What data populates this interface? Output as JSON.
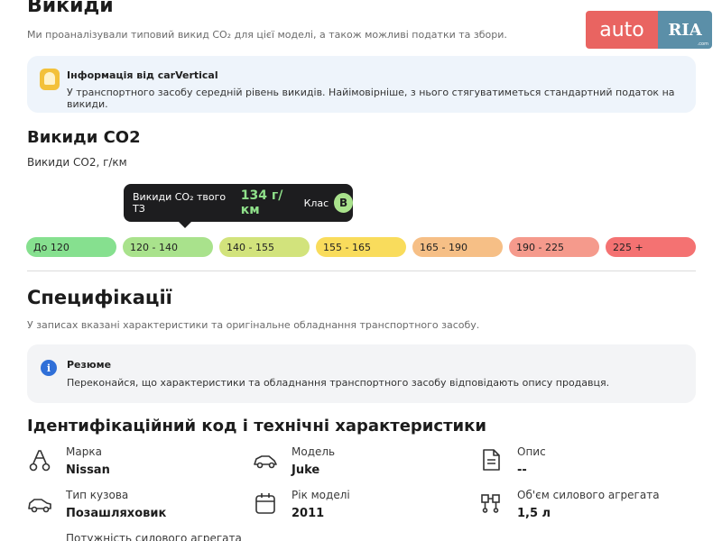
{
  "emissions": {
    "title": "Викиди",
    "subtitle": "Ми проаналізували типовий викид CO₂ для цієї моделі, а також можливі податки та збори."
  },
  "logo": {
    "auto": "auto",
    "ria": "RIA",
    "ria_suffix": ".com"
  },
  "carvertical": {
    "title": "Інформація від carVertical",
    "text": "У транспортного засобу середній рівень викидів. Найімовірніше, з нього стягуватиметься стандартний податок на викиди."
  },
  "co2": {
    "title": "Викиди CO2",
    "unit_label": "Викиди CO2, г/км",
    "tooltip": {
      "label": "Викиди CO₂ твого ТЗ",
      "value": "134 г/км",
      "class_label": "Клас",
      "class_value": "B"
    },
    "scale": [
      {
        "label": "До 120",
        "color": "#86e08f"
      },
      {
        "label": "120 - 140",
        "color": "#a9e28c"
      },
      {
        "label": "140 - 155",
        "color": "#d2e37c"
      },
      {
        "label": "155 - 165",
        "color": "#f9dc5c"
      },
      {
        "label": "165 - 190",
        "color": "#f6bf86"
      },
      {
        "label": "190 - 225",
        "color": "#f59a8c"
      },
      {
        "label": "225 +",
        "color": "#f47272"
      }
    ]
  },
  "spec": {
    "title": "Специфікації",
    "subtitle": "У записах вказані характеристики та оригінальне обладнання транспортного засобу."
  },
  "resume": {
    "title": "Резюме",
    "text": "Переконайся, що характеристики та обладнання транспортного засобу відповідають опису продавця."
  },
  "ident": {
    "title": "Ідентифікаційний код і технічні характеристики",
    "items": [
      {
        "label": "Марка",
        "value": "Nissan",
        "icon": "brand-icon"
      },
      {
        "label": "Модель",
        "value": "Juke",
        "icon": "car-icon"
      },
      {
        "label": "Опис",
        "value": "--",
        "icon": "document-icon"
      },
      {
        "label": "Тип кузова",
        "value": "Позашляховик",
        "icon": "car-body-icon"
      },
      {
        "label": "Рік моделі",
        "value": "2011",
        "icon": "calendar-icon"
      },
      {
        "label": "Об'єм силового агрегата",
        "value": "1,5 л",
        "icon": "engine-icon"
      },
      {
        "label": "Потужність силового агрегата",
        "value": "",
        "icon": "power-icon"
      }
    ]
  }
}
